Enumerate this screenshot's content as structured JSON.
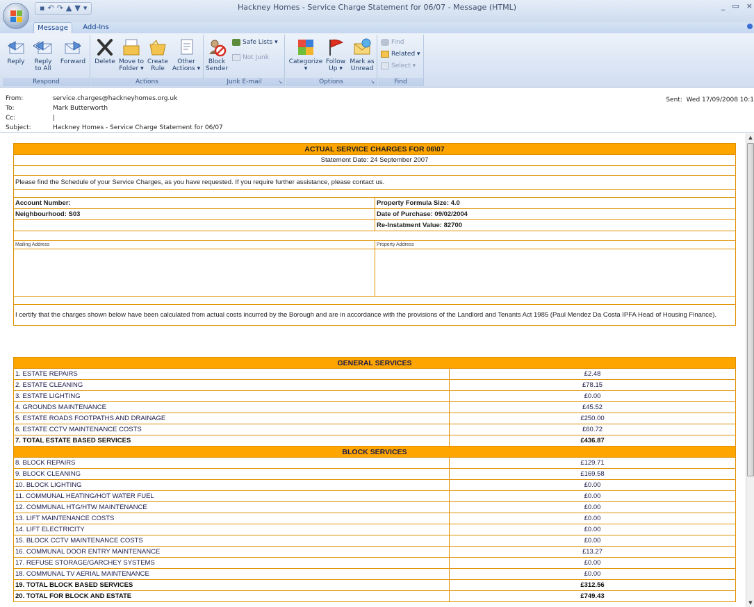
{
  "window": {
    "title": "Hackney Homes - Service Charge Statement for 06/07 - Message (HTML)",
    "minimize": "_",
    "restore": "▭",
    "close": "×"
  },
  "tabs": [
    {
      "label": "Message",
      "active": true
    },
    {
      "label": "Add-Ins",
      "active": false
    }
  ],
  "ribbon": {
    "respond": {
      "label": "Respond",
      "reply": "Reply",
      "reply_all_1": "Reply",
      "reply_all_2": "to All",
      "forward": "Forward"
    },
    "actions": {
      "label": "Actions",
      "delete": "Delete",
      "move_1": "Move to",
      "move_2": "Folder ▾",
      "create_1": "Create",
      "create_2": "Rule",
      "other_1": "Other",
      "other_2": "Actions ▾"
    },
    "junk": {
      "label": "Junk E-mail",
      "block_1": "Block",
      "block_2": "Sender",
      "safe_lists": "Safe Lists ▾",
      "not_junk": "Not Junk"
    },
    "options": {
      "label": "Options",
      "categorize": "Categorize",
      "follow_1": "Follow",
      "follow_2": "Up ▾",
      "mark_1": "Mark as",
      "mark_2": "Unread"
    },
    "find": {
      "label": "Find",
      "find": "Find",
      "related": "Related ▾",
      "select": "Select ▾"
    }
  },
  "header": {
    "from_label": "From:",
    "from": "service.charges@hackneyhomes.org.uk",
    "to_label": "To:",
    "to": "Mark Butterworth",
    "cc_label": "Cc:",
    "cc": "|",
    "subject_label": "Subject:",
    "subject": "Hackney Homes - Service Charge Statement for 06/07",
    "sent_label": "Sent:",
    "sent": "Wed 17/09/2008 10:1"
  },
  "statement": {
    "title": "ACTUAL SERVICE CHARGES FOR 06\\07",
    "date_line": "Statement Date: 24 September 2007",
    "intro": "Please find the Schedule of your Service Charges, as you have requested. If you require further assistance, please contact us.",
    "account_number": "Account Number:",
    "neighbourhood": "Neighbourhood: S03",
    "formula_size": "Property Formula Size: 4.0",
    "purchase_date": "Date of Purchase: 09/02/2004",
    "reinstatement": "Re-Instatment Value: 82700",
    "mailing_address": "Mailing Address",
    "property_address": "Property Address",
    "certify": "I certify that the charges shown below have been calculated from actual costs incurred by the Borough and are in accordance with the provisions of the Landlord and Tenants Act 1985 (Paul Mendez Da Costa IPFA Head of Housing Finance)."
  },
  "charges": {
    "general_header": "GENERAL SERVICES",
    "general": [
      {
        "label": "1. ESTATE REPAIRS",
        "amount": "£2.48"
      },
      {
        "label": "2. ESTATE CLEANING",
        "amount": "£78.15"
      },
      {
        "label": "3. ESTATE LIGHTING",
        "amount": "£0.00"
      },
      {
        "label": "4. GROUNDS MAINTENANCE",
        "amount": "£45.52"
      },
      {
        "label": "5. ESTATE ROADS FOOTPATHS AND DRAINAGE",
        "amount": "£250.00"
      },
      {
        "label": "6. ESTATE CCTV MAINTENANCE COSTS",
        "amount": "£60.72"
      }
    ],
    "estate_total": {
      "label": "7. TOTAL ESTATE BASED SERVICES",
      "amount": "£436.87"
    },
    "block_header": "BLOCK SERVICES",
    "block": [
      {
        "label": "8. BLOCK REPAIRS",
        "amount": "£129.71"
      },
      {
        "label": "9. BLOCK CLEANING",
        "amount": "£169.58"
      },
      {
        "label": "10. BLOCK LIGHTING",
        "amount": "£0.00"
      },
      {
        "label": "11. COMMUNAL HEATING/HOT WATER FUEL",
        "amount": "£0.00"
      },
      {
        "label": "12. COMMUNAL HTG/HTW MAINTENANCE",
        "amount": "£0.00"
      },
      {
        "label": "13. LIFT MAINTENANCE COSTS",
        "amount": "£0.00"
      },
      {
        "label": "14. LIFT ELECTRICITY",
        "amount": "£0.00"
      },
      {
        "label": "15. BLOCK CCTV MAINTENANCE COSTS",
        "amount": "£0.00"
      },
      {
        "label": "16. COMMUNAL DOOR ENTRY MAINTENANCE",
        "amount": "£13.27"
      },
      {
        "label": "17. REFUSE STORAGE/GARCHEY SYSTEMS",
        "amount": "£0.00"
      },
      {
        "label": "18. COMMUNAL TV AERIAL MAINTENANCE",
        "amount": "£0.00"
      }
    ],
    "block_total": {
      "label": "19. TOTAL BLOCK BASED SERVICES",
      "amount": "£312.56"
    },
    "grand_total": {
      "label": "20. TOTAL FOR BLOCK AND ESTATE",
      "amount": "£749.43"
    }
  }
}
